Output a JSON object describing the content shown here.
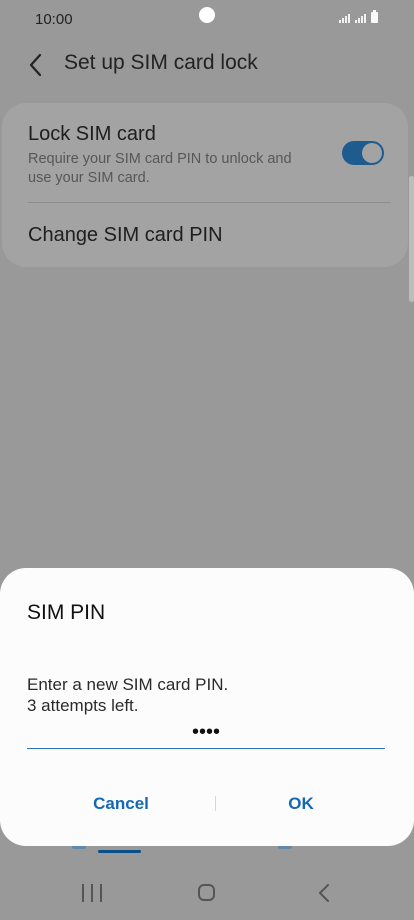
{
  "status_bar": {
    "time": "10:00",
    "icons": [
      "signal-icon",
      "signal-icon",
      "battery-icon"
    ]
  },
  "header": {
    "back_icon": "chevron-left-icon",
    "title": "Set up SIM card lock"
  },
  "settings": {
    "lock_sim": {
      "title": "Lock SIM card",
      "subtitle": "Require your SIM card PIN to unlock and use your SIM card.",
      "toggle_on": true,
      "toggle_color": "#1e5b8f"
    },
    "change_pin": {
      "title": "Change SIM card PIN"
    }
  },
  "dialog": {
    "title": "SIM PIN",
    "message_line1": "Enter a new SIM card PIN.",
    "message_line2": "3 attempts left.",
    "pin_value": "••••",
    "cancel_label": "Cancel",
    "ok_label": "OK",
    "accent_color": "#1468b8"
  },
  "nav_bar": {
    "icons": [
      "recent-apps-icon",
      "home-icon",
      "back-icon"
    ]
  }
}
